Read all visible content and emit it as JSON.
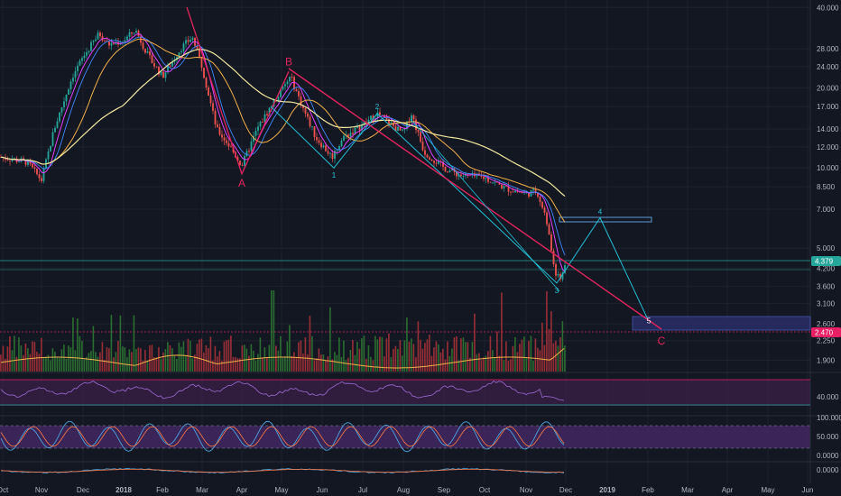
{
  "chart_data": {
    "type": "candlestick",
    "x_axis_labels": [
      "Oct",
      "Nov",
      "Dec",
      "2018",
      "Feb",
      "Mar",
      "Apr",
      "May",
      "Jun",
      "Jul",
      "Aug",
      "Sep",
      "Oct",
      "Nov",
      "Dec",
      "2019",
      "Feb",
      "Mar",
      "Apr",
      "May",
      "Jun"
    ],
    "price_axis_ticks": [
      "40.000",
      "28.000",
      "24.000",
      "20.000",
      "17.000",
      "14.000",
      "12.000",
      "10.000",
      "8.500",
      "7.000",
      "5.000",
      "4.200",
      "3.600",
      "3.100",
      "2.600",
      "2.250",
      "1.900"
    ],
    "price_scale": "log",
    "price_range": [
      1.75,
      42
    ],
    "current_price_label": "4.379",
    "target_price_label": "2.470",
    "current_price": 4.379,
    "target_price": 2.47,
    "price_series": {
      "x": [
        "Oct",
        "Nov",
        "Dec",
        "2018",
        "Feb",
        "Mar",
        "Apr",
        "May",
        "Jun",
        "Jul",
        "Aug",
        "Sep",
        "Oct",
        "Nov",
        "Dec"
      ],
      "close": [
        11.0,
        9.0,
        26.0,
        30.0,
        24.0,
        18.0,
        10.5,
        19.5,
        11.5,
        14.5,
        13.0,
        10.0,
        9.2,
        8.0,
        4.379
      ]
    },
    "elliott_waves": {
      "abc": [
        {
          "label": "A",
          "price": 9.5
        },
        {
          "label": "B",
          "price": 23.0
        },
        {
          "label": "C",
          "price": 2.47
        }
      ],
      "impulse": [
        {
          "label": "1",
          "price": 10.0
        },
        {
          "label": "2",
          "price": 16.0
        },
        {
          "label": "3",
          "price": 3.7
        },
        {
          "label": "4",
          "price": 6.5
        },
        {
          "label": "5",
          "price": 2.7
        }
      ]
    },
    "target_zone": {
      "high": 2.8,
      "low": 2.5,
      "color": "#3a3f8f"
    },
    "resistance_zone": {
      "price": 6.5,
      "color": "#5b9bd5"
    },
    "indicator1_ticks": [
      "40.000"
    ],
    "indicator2_ticks": [
      "100.000",
      "50.000",
      "0.0000"
    ],
    "indicator3_ticks": [
      "0.0000"
    ],
    "colors": {
      "up": "#26a69a",
      "down": "#ef5350",
      "abc": "#e0245e",
      "impulse": "#22c1d6",
      "ma_long": "#f3e8a0",
      "ma_mid": "#f0b04a",
      "ma_short": "#e040fb",
      "price_label": "#26a69a",
      "target_label": "#e91e63"
    }
  }
}
